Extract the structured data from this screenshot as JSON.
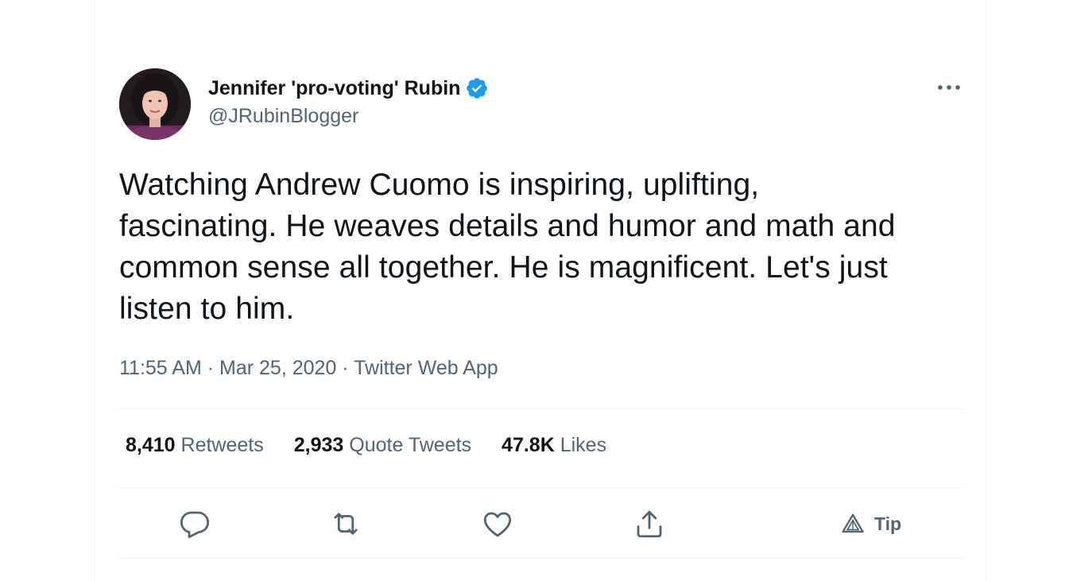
{
  "author": {
    "display_name": "Jennifer 'pro-voting' Rubin",
    "handle": "@JRubinBlogger",
    "verified": true
  },
  "tweet": {
    "text": "Watching Andrew Cuomo is inspiring, uplifting, fascinating. He weaves details and humor and math and common sense all together. He is magnificent. Let's just listen to him.",
    "time": "11:55 AM",
    "separator": "·",
    "date": "Mar 25, 2020",
    "source": "Twitter Web App"
  },
  "stats": {
    "retweets_count": "8,410",
    "retweets_label": "Retweets",
    "quote_count": "2,933",
    "quote_label": "Quote Tweets",
    "likes_count": "47.8K",
    "likes_label": "Likes"
  },
  "actions": {
    "tip_label": "Tip"
  },
  "icons": {
    "verified": "verified-badge-icon",
    "more": "more-options-icon",
    "reply": "reply-icon",
    "retweet": "retweet-icon",
    "like": "heart-icon",
    "share": "share-icon",
    "tip": "tip-icon"
  },
  "colors": {
    "primary_text": "#0f1419",
    "secondary_text": "#536471",
    "verified_blue": "#1d9bf0",
    "border": "#eff3f4"
  }
}
